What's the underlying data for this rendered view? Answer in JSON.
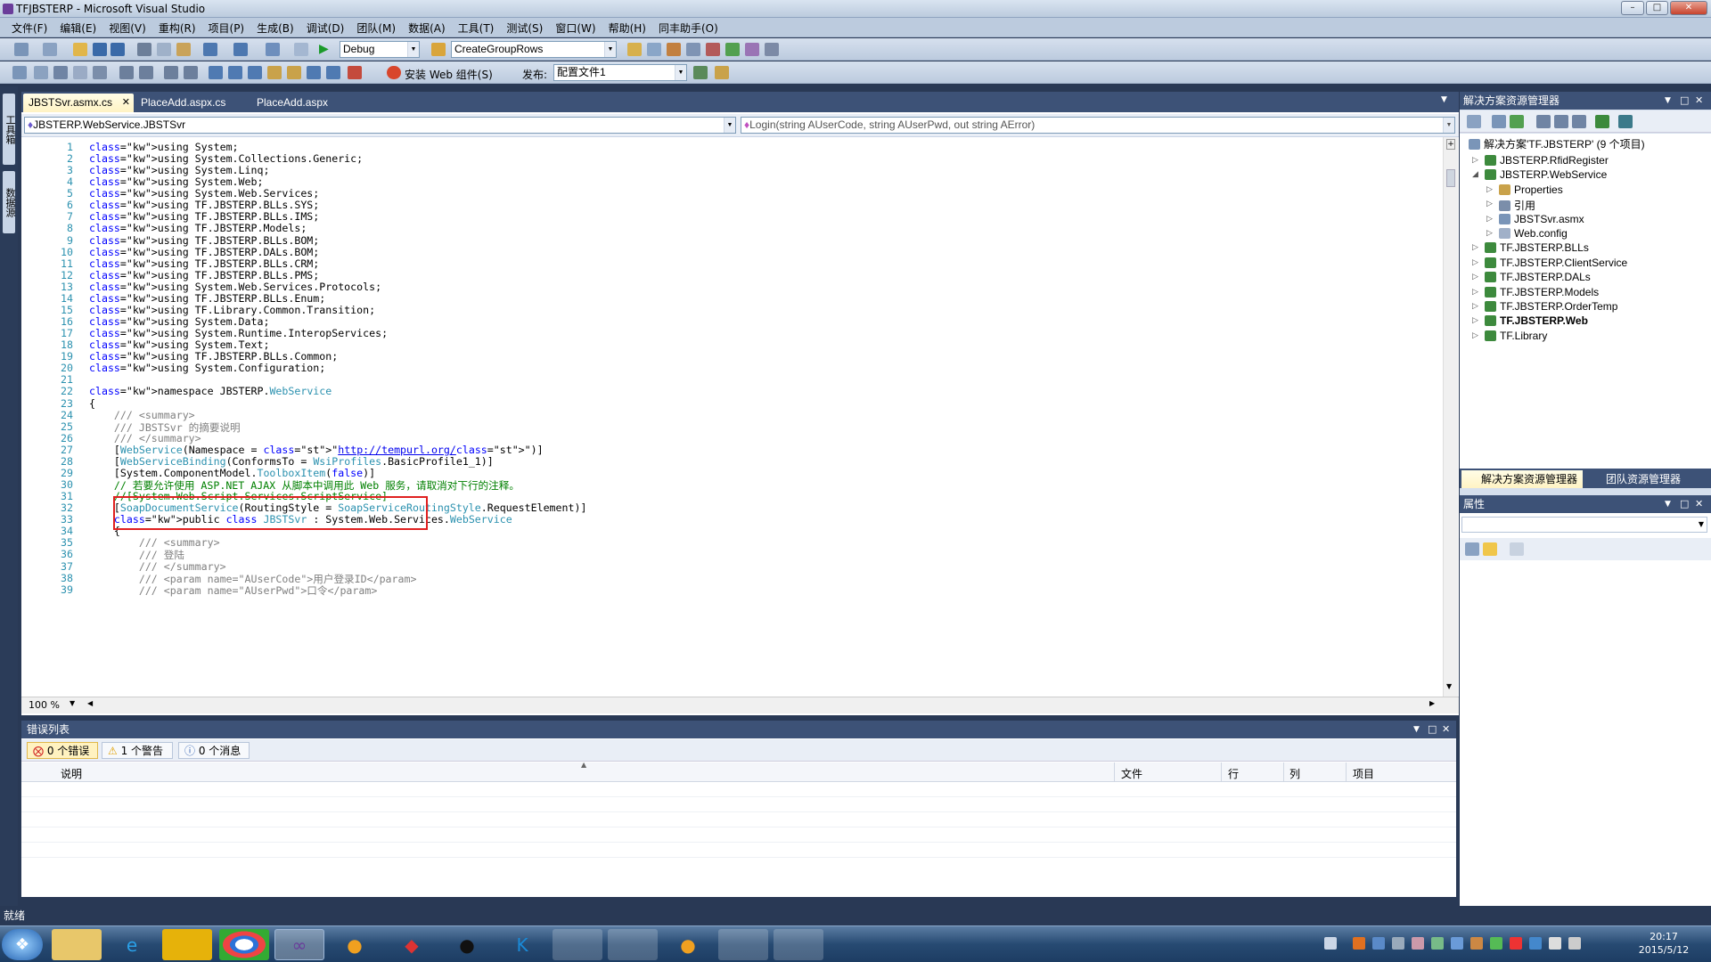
{
  "window": {
    "title": "TFJBSTERP - Microsoft Visual Studio"
  },
  "menu": [
    "文件(F)",
    "编辑(E)",
    "视图(V)",
    "重构(R)",
    "项目(P)",
    "生成(B)",
    "调试(D)",
    "团队(M)",
    "数据(A)",
    "工具(T)",
    "测试(S)",
    "窗口(W)",
    "帮助(H)",
    "同丰助手(O)"
  ],
  "toolbar": {
    "config": "Debug",
    "find_combo": "CreateGroupRows",
    "install_web": "安装 Web 组件(S)",
    "publish_label": "发布:",
    "publish_profile": "配置文件1"
  },
  "tabs": [
    {
      "label": "JBSTSvr.asmx.cs",
      "active": true
    },
    {
      "label": "PlaceAdd.aspx.cs",
      "active": false
    },
    {
      "label": "PlaceAdd.aspx",
      "active": false
    }
  ],
  "nav": {
    "class_combo": "JBSTERP.WebService.JBSTSvr",
    "member_combo": "Login(string AUserCode, string AUserPwd, out string AError)"
  },
  "code_lines": [
    "using System;",
    "using System.Collections.Generic;",
    "using System.Linq;",
    "using System.Web;",
    "using System.Web.Services;",
    "using TF.JBSTERP.BLLs.SYS;",
    "using TF.JBSTERP.BLLs.IMS;",
    "using TF.JBSTERP.Models;",
    "using TF.JBSTERP.BLLs.BOM;",
    "using TF.JBSTERP.DALs.BOM;",
    "using TF.JBSTERP.BLLs.CRM;",
    "using TF.JBSTERP.BLLs.PMS;",
    "using System.Web.Services.Protocols;",
    "using TF.JBSTERP.BLLs.Enum;",
    "using TF.Library.Common.Transition;",
    "using System.Data;",
    "using System.Runtime.InteropServices;",
    "using System.Text;",
    "using TF.JBSTERP.BLLs.Common;",
    "using System.Configuration;",
    "",
    "namespace JBSTERP.WebService",
    "{",
    "    /// <summary>",
    "    /// JBSTSvr 的摘要说明",
    "    /// </summary>",
    "    [WebService(Namespace = \"http://tempurl.org/\")]",
    "    [WebServiceBinding(ConformsTo = WsiProfiles.BasicProfile1_1)]",
    "    [System.ComponentModel.ToolboxItem(false)]",
    "    // 若要允许使用 ASP.NET AJAX 从脚本中调用此 Web 服务，请取消对下行的注释。",
    "    //[System.Web.Script.Services.ScriptService]",
    "    [SoapDocumentService(RoutingStyle = SoapServiceRoutingStyle.RequestElement)]",
    "    public class JBSTSvr : System.Web.Services.WebService",
    "    {",
    "        /// <summary>",
    "        /// 登陆",
    "        /// </summary>",
    "        /// <param name=\"AUserCode\">用户登录ID</param>",
    "        /// <param name=\"AUserPwd\">口令</param>"
  ],
  "zoom": "100 %",
  "error_list": {
    "title": "错误列表",
    "errors": "0 个错误",
    "warnings": "1 个警告",
    "messages": "0 个消息",
    "columns": [
      "说明",
      "文件",
      "行",
      "列",
      "项目"
    ]
  },
  "solution_explorer": {
    "title": "解决方案资源管理器",
    "root": "解决方案'TF.JBSTERP' (9 个项目)",
    "items": [
      {
        "label": "JBSTERP.RfidRegister",
        "level": 1,
        "bold": false
      },
      {
        "label": "JBSTERP.WebService",
        "level": 1,
        "bold": false
      },
      {
        "label": "Properties",
        "level": 2,
        "bold": false
      },
      {
        "label": "引用",
        "level": 2,
        "bold": false
      },
      {
        "label": "JBSTSvr.asmx",
        "level": 2,
        "bold": false
      },
      {
        "label": "Web.config",
        "level": 2,
        "bold": false
      },
      {
        "label": "TF.JBSTERP.BLLs",
        "level": 1,
        "bold": false
      },
      {
        "label": "TF.JBSTERP.ClientService",
        "level": 1,
        "bold": false
      },
      {
        "label": "TF.JBSTERP.DALs",
        "level": 1,
        "bold": false
      },
      {
        "label": "TF.JBSTERP.Models",
        "level": 1,
        "bold": false
      },
      {
        "label": "TF.JBSTERP.OrderTemp",
        "level": 1,
        "bold": false
      },
      {
        "label": "TF.JBSTERP.Web",
        "level": 1,
        "bold": true
      },
      {
        "label": "TF.Library",
        "level": 1,
        "bold": false
      }
    ],
    "tab_solution": "解决方案资源管理器",
    "tab_team": "团队资源管理器"
  },
  "properties": {
    "title": "属性"
  },
  "left_strip": {
    "toolbox": "工具箱",
    "datasource": "数据源"
  },
  "status": "就绪",
  "clock": {
    "time": "20:17",
    "date": "2015/5/12"
  },
  "colors": {
    "accent": "#3d5277",
    "frame": "#293955",
    "highlight": "#e02020"
  }
}
